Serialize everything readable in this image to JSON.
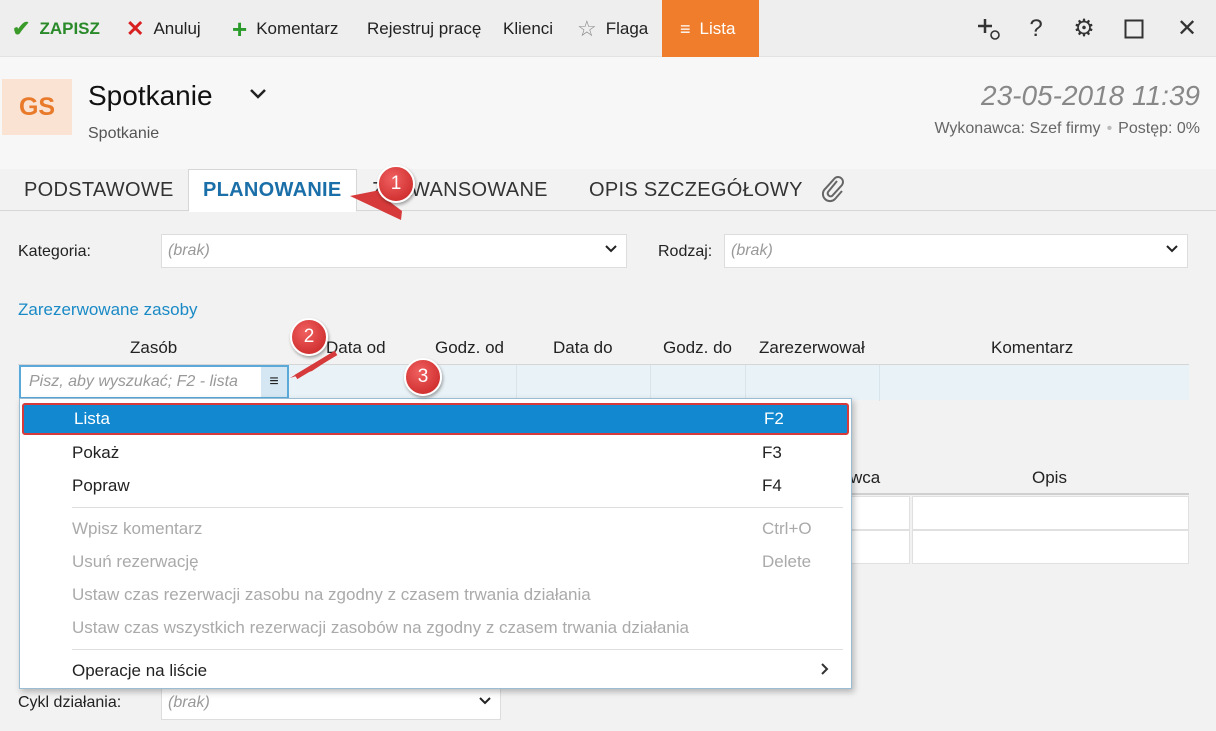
{
  "toolbar": {
    "save": "ZAPISZ",
    "cancel": "Anuluj",
    "comment": "Komentarz",
    "register_work": "Rejestruj pracę",
    "clients": "Klienci",
    "flag": "Flaga",
    "list": "Lista",
    "right_icons": [
      "add-link-icon",
      "help-icon",
      "gear-icon",
      "maximize-icon",
      "close-icon"
    ]
  },
  "header": {
    "avatar": "GS",
    "title": "Spotkanie",
    "subtitle": "Spotkanie",
    "date": "23-05-2018 11:39",
    "performer": "Wykonawca: Szef firmy",
    "progress": "Postęp: 0%"
  },
  "tabs": [
    "PODSTAWOWE",
    "PLANOWANIE",
    "ZAAWANSOWANE",
    "OPIS SZCZEGÓŁOWY"
  ],
  "active_tab": "PLANOWANIE",
  "form": {
    "category_label": "Kategoria:",
    "category_value": "(brak)",
    "type_label": "Rodzaj:",
    "type_value": "(brak)",
    "cycle_label": "Cykl działania:",
    "cycle_value": "(brak)"
  },
  "reserved": {
    "section_title": "Zarezerwowane zasoby",
    "columns": [
      "Zasób",
      "Data od",
      "Godz. od",
      "Data do",
      "Godz. do",
      "Zarezerwował",
      "Komentarz"
    ],
    "search_placeholder": "Pisz, aby wyszukać; F2 - lista"
  },
  "background_columns": [
    "wca",
    "Opis"
  ],
  "menu": {
    "items": [
      {
        "label": "Lista",
        "key": "F2"
      },
      {
        "label": "Pokaż",
        "key": "F3"
      },
      {
        "label": "Popraw",
        "key": "F4"
      },
      {
        "label": "Wpisz komentarz",
        "key": "Ctrl+O"
      },
      {
        "label": "Usuń rezerwację",
        "key": "Delete"
      },
      {
        "label": "Ustaw czas rezerwacji zasobu na zgodny z czasem trwania działania",
        "key": ""
      },
      {
        "label": "Ustaw czas wszystkich rezerwacji zasobów na zgodny z czasem trwania działania",
        "key": ""
      },
      {
        "label": "Operacje na liście",
        "key": ""
      }
    ]
  },
  "annotations": [
    "1",
    "2",
    "3"
  ],
  "colors": {
    "accent": "#ef7d2b",
    "link": "#1a8ac6",
    "selection": "#1188cf",
    "annotation": "#d63a3a"
  }
}
